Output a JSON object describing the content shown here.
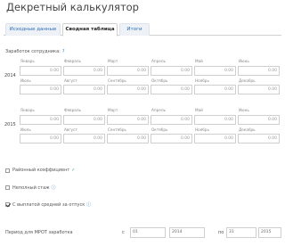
{
  "title": "Декретный калькулятор",
  "tabs": [
    {
      "label": "Исходные данные"
    },
    {
      "label": "Сводная таблица"
    },
    {
      "label": "Итоги"
    }
  ],
  "section_label": "Заработок сотрудника:",
  "years": [
    {
      "label": "2014",
      "top_row": [
        {
          "month": "Январь",
          "value": "0.00"
        },
        {
          "month": "Февраль",
          "value": "0.00"
        },
        {
          "month": "Март",
          "value": "0.00"
        },
        {
          "month": "Апрель",
          "value": "0.00"
        },
        {
          "month": "Май",
          "value": "0.00"
        },
        {
          "month": "Июнь",
          "value": "0.00"
        }
      ],
      "bottom_row": [
        {
          "month": "Июль",
          "value": "0.00"
        },
        {
          "month": "Август",
          "value": "0.00"
        },
        {
          "month": "Сентябрь",
          "value": "0.00"
        },
        {
          "month": "Октябрь",
          "value": "0.00"
        },
        {
          "month": "Ноябрь",
          "value": "0.00"
        },
        {
          "month": "Декабрь",
          "value": "0.00"
        }
      ]
    },
    {
      "label": "2015",
      "top_row": [
        {
          "month": "Январь",
          "value": "0.00"
        },
        {
          "month": "Февраль",
          "value": "0.00"
        },
        {
          "month": "Март",
          "value": "0.00"
        },
        {
          "month": "Апрель",
          "value": "0.00"
        },
        {
          "month": "Май",
          "value": "0.00"
        },
        {
          "month": "Июнь",
          "value": "0.00"
        }
      ],
      "bottom_row": [
        {
          "month": "Июль",
          "value": "0.00"
        },
        {
          "month": "Август",
          "value": "0.00"
        },
        {
          "month": "Сентябрь",
          "value": "0.00"
        },
        {
          "month": "Октябрь",
          "value": "0.00"
        },
        {
          "month": "Ноябрь",
          "value": "0.00"
        },
        {
          "month": "Декабрь",
          "value": "0.00"
        }
      ]
    }
  ],
  "options": [
    {
      "label": "Районный коэффициент",
      "checked": false,
      "icon": "check-icon"
    },
    {
      "label": "Неполный стаж",
      "checked": false,
      "icon": "info-icon"
    },
    {
      "label": "С выплатой средней за отпуск",
      "checked": true,
      "icon": "info-icon"
    }
  ],
  "bottom": {
    "label": "Период для МРОТ заработка",
    "from_label": "с",
    "to_label": "по",
    "date_from_day": "01",
    "date_from_year": "2014",
    "date_to_day": "31",
    "date_to_year": "2015"
  }
}
